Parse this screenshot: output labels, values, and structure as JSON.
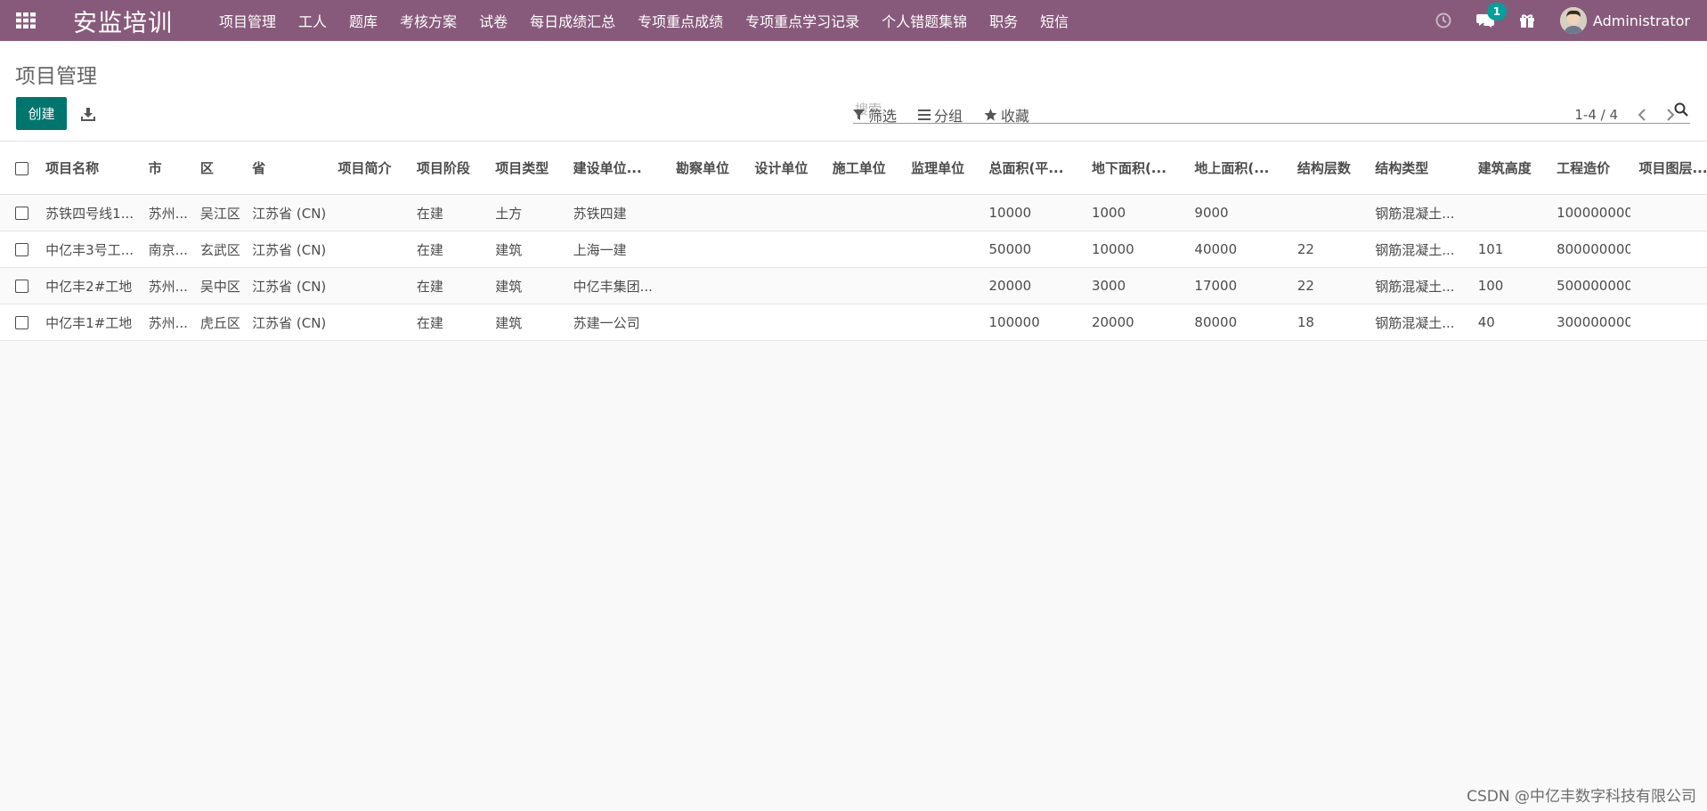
{
  "navbar": {
    "app_title": "安监培训",
    "menu": [
      "项目管理",
      "工人",
      "题库",
      "考核方案",
      "试卷",
      "每日成绩汇总",
      "专项重点成绩",
      "专项重点学习记录",
      "个人错题集锦",
      "职务",
      "短信"
    ],
    "message_count": "1",
    "user_name": "Administrator"
  },
  "control_panel": {
    "title": "项目管理",
    "create_label": "创建",
    "search_placeholder": "搜索...",
    "filter_label": "筛选",
    "group_label": "分组",
    "favorite_label": "收藏",
    "pager_text": "1-4 / 4"
  },
  "table": {
    "columns": [
      "项目名称",
      "市",
      "区",
      "省",
      "项目简介",
      "项目阶段",
      "项目类型",
      "建设单位...",
      "勘察单位",
      "设计单位",
      "施工单位",
      "监理单位",
      "总面积(平...",
      "地下面积(...",
      "地上面积(...",
      "结构层数",
      "结构类型",
      "建筑高度",
      "工程造价",
      "项目图层..."
    ],
    "rows": [
      [
        "苏铁四号线1...",
        "苏州...",
        "吴江区",
        "江苏省 (CN)",
        "",
        "在建",
        "土方",
        "苏铁四建",
        "",
        "",
        "",
        "",
        "10000",
        "1000",
        "9000",
        "",
        "钢筋混凝土...",
        "",
        "100000000",
        ""
      ],
      [
        "中亿丰3号工...",
        "南京...",
        "玄武区",
        "江苏省 (CN)",
        "",
        "在建",
        "建筑",
        "上海一建",
        "",
        "",
        "",
        "",
        "50000",
        "10000",
        "40000",
        "22",
        "钢筋混凝土...",
        "101",
        "800000000",
        ""
      ],
      [
        "中亿丰2#工地",
        "苏州...",
        "吴中区",
        "江苏省 (CN)",
        "",
        "在建",
        "建筑",
        "中亿丰集团...",
        "",
        "",
        "",
        "",
        "20000",
        "3000",
        "17000",
        "22",
        "钢筋混凝土...",
        "100",
        "500000000",
        ""
      ],
      [
        "中亿丰1#工地",
        "苏州...",
        "虎丘区",
        "江苏省 (CN)",
        "",
        "在建",
        "建筑",
        "苏建一公司",
        "",
        "",
        "",
        "",
        "100000",
        "20000",
        "80000",
        "18",
        "钢筋混凝土...",
        "40",
        "300000000",
        ""
      ]
    ]
  },
  "watermark": "CSDN @中亿丰数字科技有限公司",
  "colors": {
    "navbar": "#875a7b",
    "primary_button": "#00756e",
    "badge": "#00a09d"
  },
  "icons": [
    "apps-grid-icon",
    "clock-icon",
    "chat-icon",
    "gift-icon",
    "download-icon",
    "search-icon",
    "filter-icon",
    "list-icon",
    "star-icon",
    "chevron-left-icon",
    "chevron-right-icon"
  ]
}
